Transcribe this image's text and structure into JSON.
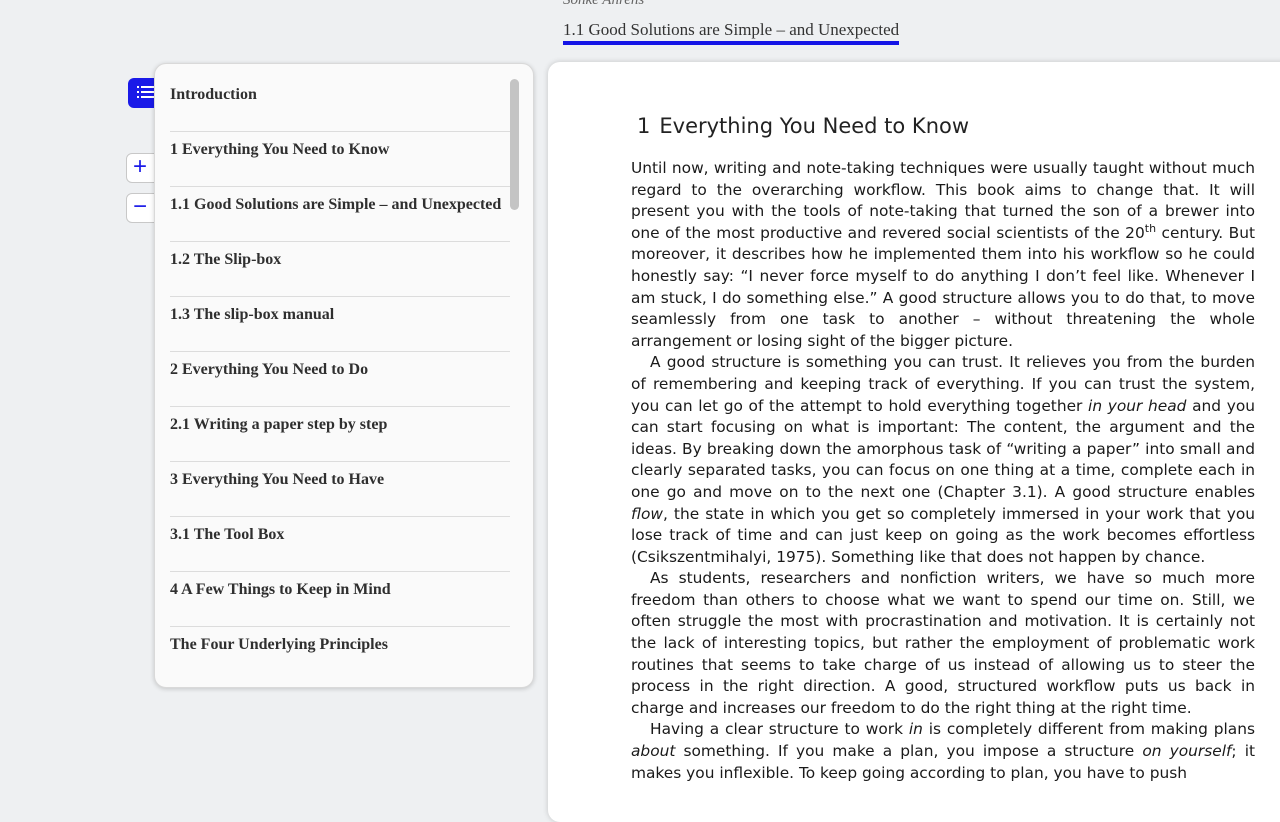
{
  "header": {
    "author": "Sönke Ahrens",
    "current_chapter": "1.1 Good Solutions are Simple – and Unexpected"
  },
  "controls": {
    "zoom_in": "+",
    "zoom_out": "−"
  },
  "toc": {
    "items": [
      "Introduction",
      "1 Everything You Need to Know",
      "1.1 Good Solutions are Simple – and Unexpected",
      "1.2 The Slip-box",
      "1.3 The slip-box manual",
      "2 Everything You Need to Do",
      "2.1 Writing a paper step by step",
      "3 Everything You Need to Have",
      "3.1 The Tool Box",
      "4 A Few Things to Keep in Mind",
      "The Four Underlying Principles"
    ]
  },
  "page": {
    "heading_number": "1",
    "heading_title": "Everything You Need to Know",
    "p1_a": "Until now, writing and note-taking techniques were usually taught without much regard to the overarching workflow. This book aims to change that. It will present you with the tools of note-taking that turned the son of a brewer into one of the most productive and revered social scientists of the 20",
    "p1_sup": "th",
    "p1_b": " century. But moreover, it describes how he implemented them into his workflow so he could honestly say: “I never force myself to do anything I don’t feel like. Whenever I am stuck, I do something else.” A good structure allows you to do that, to move seamlessly from one task to another – without threatening the whole arrangement or losing sight of the bigger picture.",
    "p2_a": "A good structure is something you can trust. It relieves you from the burden of remembering and keeping track of everything. If you can trust the system, you can let go of the attempt to hold everything together ",
    "p2_em1": "in your head",
    "p2_b": " and you can start focusing on what is important: The content, the argument and the ideas. By breaking down the amorphous task of “writing a paper” into small and clearly separated tasks, you can focus on one thing at a time, complete each in one go and move on to the next one (Chapter 3.1). A good structure enables ",
    "p2_em2": "flow",
    "p2_c": ", the state in which you get so completely immersed in your work that you lose track of time and can just keep on going as the work becomes effortless (Csikszentmihalyi, 1975). Something like that does not happen by chance.",
    "p3": "As students, researchers and nonfiction writers, we have so much more freedom than others to choose what we want to spend our time on. Still, we often struggle the most with procrastination and motivation. It is certainly not the lack of interesting topics, but rather the employment of problematic work routines that seems to take charge of us instead of allowing us to steer the process in the right direction. A good, structured workflow puts us back in charge and increases our freedom to do the right thing at the right time.",
    "p4_a": "Having a clear structure to work ",
    "p4_em1": "in",
    "p4_b": " is completely different from making plans ",
    "p4_em2": "about",
    "p4_c": " something. If you make a plan, you impose a structure ",
    "p4_em3": "on yourself",
    "p4_d": "; it makes you inflexible. To keep going according to plan, you have to push"
  }
}
